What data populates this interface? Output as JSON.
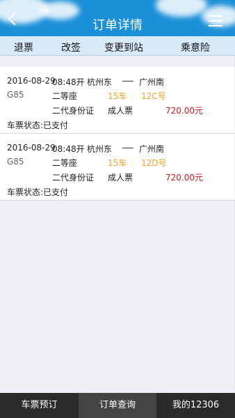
{
  "header": {
    "title": "订单详情",
    "back_icon": "chevron-left-icon",
    "menu_icon": "list-menu-icon"
  },
  "actions": {
    "refund": "退票",
    "change": "改签",
    "change_station": "变更到站",
    "insurance": "乘意险"
  },
  "tickets": [
    {
      "date": "2016-08-29",
      "time": "08:48开",
      "from": "杭州东",
      "to": "广州南",
      "train": "G85",
      "seat_class": "二等座",
      "coach": "15车",
      "seat_no": "12C号",
      "id_type": "二代身份证",
      "ticket_type": "成人票",
      "price": "720.00元",
      "status": "车票状态:已支付"
    },
    {
      "date": "2016-08-29",
      "time": "08:48开",
      "from": "杭州东",
      "to": "广州南",
      "train": "G85",
      "seat_class": "二等座",
      "coach": "15车",
      "seat_no": "12D号",
      "id_type": "二代身份证",
      "ticket_type": "成人票",
      "price": "720.00元",
      "status": "车票状态:已支付"
    }
  ],
  "tabs": {
    "booking": "车票预订",
    "orders": "订单查询",
    "mine": "我的12306"
  }
}
